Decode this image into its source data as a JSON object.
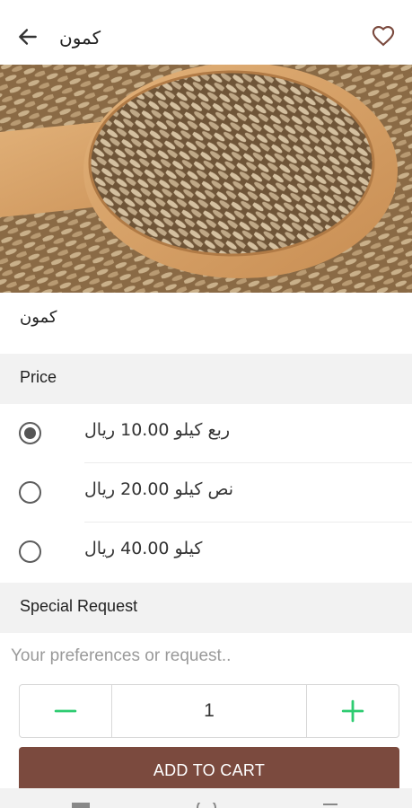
{
  "header": {
    "title": "كمون",
    "back_icon": "arrow-left-icon",
    "favorite_icon": "heart-outline-icon"
  },
  "product": {
    "name": "كمون"
  },
  "price_section": {
    "title": "Price",
    "options": [
      {
        "label": "ربع كيلو  10.00 ريال",
        "selected": true
      },
      {
        "label": "نص كيلو  20.00 ريال",
        "selected": false
      },
      {
        "label": "كيلو  40.00 ريال",
        "selected": false
      }
    ]
  },
  "special_request": {
    "title": "Special Request",
    "placeholder": "Your preferences or request.."
  },
  "quantity": {
    "value": "1",
    "decrement_icon": "minus-icon",
    "increment_icon": "plus-icon"
  },
  "cart_button": {
    "label": "ADD TO CART"
  },
  "colors": {
    "accent": "#7b4a3e",
    "stepper_icon": "#2ecc71"
  }
}
